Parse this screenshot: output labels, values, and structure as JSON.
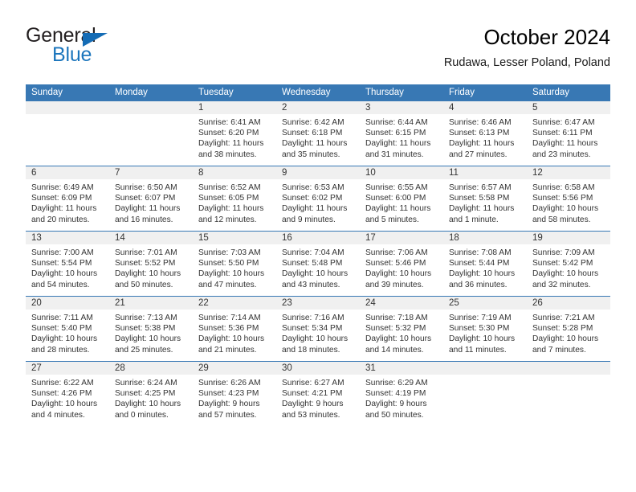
{
  "brand": {
    "name_top": "General",
    "name_bottom": "Blue",
    "color_dark": "#231f20",
    "color_blue": "#1b75bc"
  },
  "header": {
    "title": "October 2024",
    "subtitle": "Rudawa, Lesser Poland, Poland"
  },
  "theme": {
    "header_bg": "#3878b4",
    "header_text": "#ffffff",
    "daynum_band_bg": "#f0f0f0",
    "cell_bg": "#ffffff",
    "row_divider": "#3878b4",
    "body_text": "#333333"
  },
  "weekdays": [
    "Sunday",
    "Monday",
    "Tuesday",
    "Wednesday",
    "Thursday",
    "Friday",
    "Saturday"
  ],
  "labels": {
    "sunrise_prefix": "Sunrise:",
    "sunset_prefix": "Sunset:",
    "daylight_prefix": "Daylight:"
  },
  "weeks": [
    [
      {
        "day": ""
      },
      {
        "day": ""
      },
      {
        "day": "1",
        "sunrise": "Sunrise: 6:41 AM",
        "sunset": "Sunset: 6:20 PM",
        "daylight_line1": "Daylight: 11 hours",
        "daylight_line2": "and 38 minutes."
      },
      {
        "day": "2",
        "sunrise": "Sunrise: 6:42 AM",
        "sunset": "Sunset: 6:18 PM",
        "daylight_line1": "Daylight: 11 hours",
        "daylight_line2": "and 35 minutes."
      },
      {
        "day": "3",
        "sunrise": "Sunrise: 6:44 AM",
        "sunset": "Sunset: 6:15 PM",
        "daylight_line1": "Daylight: 11 hours",
        "daylight_line2": "and 31 minutes."
      },
      {
        "day": "4",
        "sunrise": "Sunrise: 6:46 AM",
        "sunset": "Sunset: 6:13 PM",
        "daylight_line1": "Daylight: 11 hours",
        "daylight_line2": "and 27 minutes."
      },
      {
        "day": "5",
        "sunrise": "Sunrise: 6:47 AM",
        "sunset": "Sunset: 6:11 PM",
        "daylight_line1": "Daylight: 11 hours",
        "daylight_line2": "and 23 minutes."
      }
    ],
    [
      {
        "day": "6",
        "sunrise": "Sunrise: 6:49 AM",
        "sunset": "Sunset: 6:09 PM",
        "daylight_line1": "Daylight: 11 hours",
        "daylight_line2": "and 20 minutes."
      },
      {
        "day": "7",
        "sunrise": "Sunrise: 6:50 AM",
        "sunset": "Sunset: 6:07 PM",
        "daylight_line1": "Daylight: 11 hours",
        "daylight_line2": "and 16 minutes."
      },
      {
        "day": "8",
        "sunrise": "Sunrise: 6:52 AM",
        "sunset": "Sunset: 6:05 PM",
        "daylight_line1": "Daylight: 11 hours",
        "daylight_line2": "and 12 minutes."
      },
      {
        "day": "9",
        "sunrise": "Sunrise: 6:53 AM",
        "sunset": "Sunset: 6:02 PM",
        "daylight_line1": "Daylight: 11 hours",
        "daylight_line2": "and 9 minutes."
      },
      {
        "day": "10",
        "sunrise": "Sunrise: 6:55 AM",
        "sunset": "Sunset: 6:00 PM",
        "daylight_line1": "Daylight: 11 hours",
        "daylight_line2": "and 5 minutes."
      },
      {
        "day": "11",
        "sunrise": "Sunrise: 6:57 AM",
        "sunset": "Sunset: 5:58 PM",
        "daylight_line1": "Daylight: 11 hours",
        "daylight_line2": "and 1 minute."
      },
      {
        "day": "12",
        "sunrise": "Sunrise: 6:58 AM",
        "sunset": "Sunset: 5:56 PM",
        "daylight_line1": "Daylight: 10 hours",
        "daylight_line2": "and 58 minutes."
      }
    ],
    [
      {
        "day": "13",
        "sunrise": "Sunrise: 7:00 AM",
        "sunset": "Sunset: 5:54 PM",
        "daylight_line1": "Daylight: 10 hours",
        "daylight_line2": "and 54 minutes."
      },
      {
        "day": "14",
        "sunrise": "Sunrise: 7:01 AM",
        "sunset": "Sunset: 5:52 PM",
        "daylight_line1": "Daylight: 10 hours",
        "daylight_line2": "and 50 minutes."
      },
      {
        "day": "15",
        "sunrise": "Sunrise: 7:03 AM",
        "sunset": "Sunset: 5:50 PM",
        "daylight_line1": "Daylight: 10 hours",
        "daylight_line2": "and 47 minutes."
      },
      {
        "day": "16",
        "sunrise": "Sunrise: 7:04 AM",
        "sunset": "Sunset: 5:48 PM",
        "daylight_line1": "Daylight: 10 hours",
        "daylight_line2": "and 43 minutes."
      },
      {
        "day": "17",
        "sunrise": "Sunrise: 7:06 AM",
        "sunset": "Sunset: 5:46 PM",
        "daylight_line1": "Daylight: 10 hours",
        "daylight_line2": "and 39 minutes."
      },
      {
        "day": "18",
        "sunrise": "Sunrise: 7:08 AM",
        "sunset": "Sunset: 5:44 PM",
        "daylight_line1": "Daylight: 10 hours",
        "daylight_line2": "and 36 minutes."
      },
      {
        "day": "19",
        "sunrise": "Sunrise: 7:09 AM",
        "sunset": "Sunset: 5:42 PM",
        "daylight_line1": "Daylight: 10 hours",
        "daylight_line2": "and 32 minutes."
      }
    ],
    [
      {
        "day": "20",
        "sunrise": "Sunrise: 7:11 AM",
        "sunset": "Sunset: 5:40 PM",
        "daylight_line1": "Daylight: 10 hours",
        "daylight_line2": "and 28 minutes."
      },
      {
        "day": "21",
        "sunrise": "Sunrise: 7:13 AM",
        "sunset": "Sunset: 5:38 PM",
        "daylight_line1": "Daylight: 10 hours",
        "daylight_line2": "and 25 minutes."
      },
      {
        "day": "22",
        "sunrise": "Sunrise: 7:14 AM",
        "sunset": "Sunset: 5:36 PM",
        "daylight_line1": "Daylight: 10 hours",
        "daylight_line2": "and 21 minutes."
      },
      {
        "day": "23",
        "sunrise": "Sunrise: 7:16 AM",
        "sunset": "Sunset: 5:34 PM",
        "daylight_line1": "Daylight: 10 hours",
        "daylight_line2": "and 18 minutes."
      },
      {
        "day": "24",
        "sunrise": "Sunrise: 7:18 AM",
        "sunset": "Sunset: 5:32 PM",
        "daylight_line1": "Daylight: 10 hours",
        "daylight_line2": "and 14 minutes."
      },
      {
        "day": "25",
        "sunrise": "Sunrise: 7:19 AM",
        "sunset": "Sunset: 5:30 PM",
        "daylight_line1": "Daylight: 10 hours",
        "daylight_line2": "and 11 minutes."
      },
      {
        "day": "26",
        "sunrise": "Sunrise: 7:21 AM",
        "sunset": "Sunset: 5:28 PM",
        "daylight_line1": "Daylight: 10 hours",
        "daylight_line2": "and 7 minutes."
      }
    ],
    [
      {
        "day": "27",
        "sunrise": "Sunrise: 6:22 AM",
        "sunset": "Sunset: 4:26 PM",
        "daylight_line1": "Daylight: 10 hours",
        "daylight_line2": "and 4 minutes."
      },
      {
        "day": "28",
        "sunrise": "Sunrise: 6:24 AM",
        "sunset": "Sunset: 4:25 PM",
        "daylight_line1": "Daylight: 10 hours",
        "daylight_line2": "and 0 minutes."
      },
      {
        "day": "29",
        "sunrise": "Sunrise: 6:26 AM",
        "sunset": "Sunset: 4:23 PM",
        "daylight_line1": "Daylight: 9 hours",
        "daylight_line2": "and 57 minutes."
      },
      {
        "day": "30",
        "sunrise": "Sunrise: 6:27 AM",
        "sunset": "Sunset: 4:21 PM",
        "daylight_line1": "Daylight: 9 hours",
        "daylight_line2": "and 53 minutes."
      },
      {
        "day": "31",
        "sunrise": "Sunrise: 6:29 AM",
        "sunset": "Sunset: 4:19 PM",
        "daylight_line1": "Daylight: 9 hours",
        "daylight_line2": "and 50 minutes."
      },
      {
        "day": ""
      },
      {
        "day": ""
      }
    ]
  ]
}
